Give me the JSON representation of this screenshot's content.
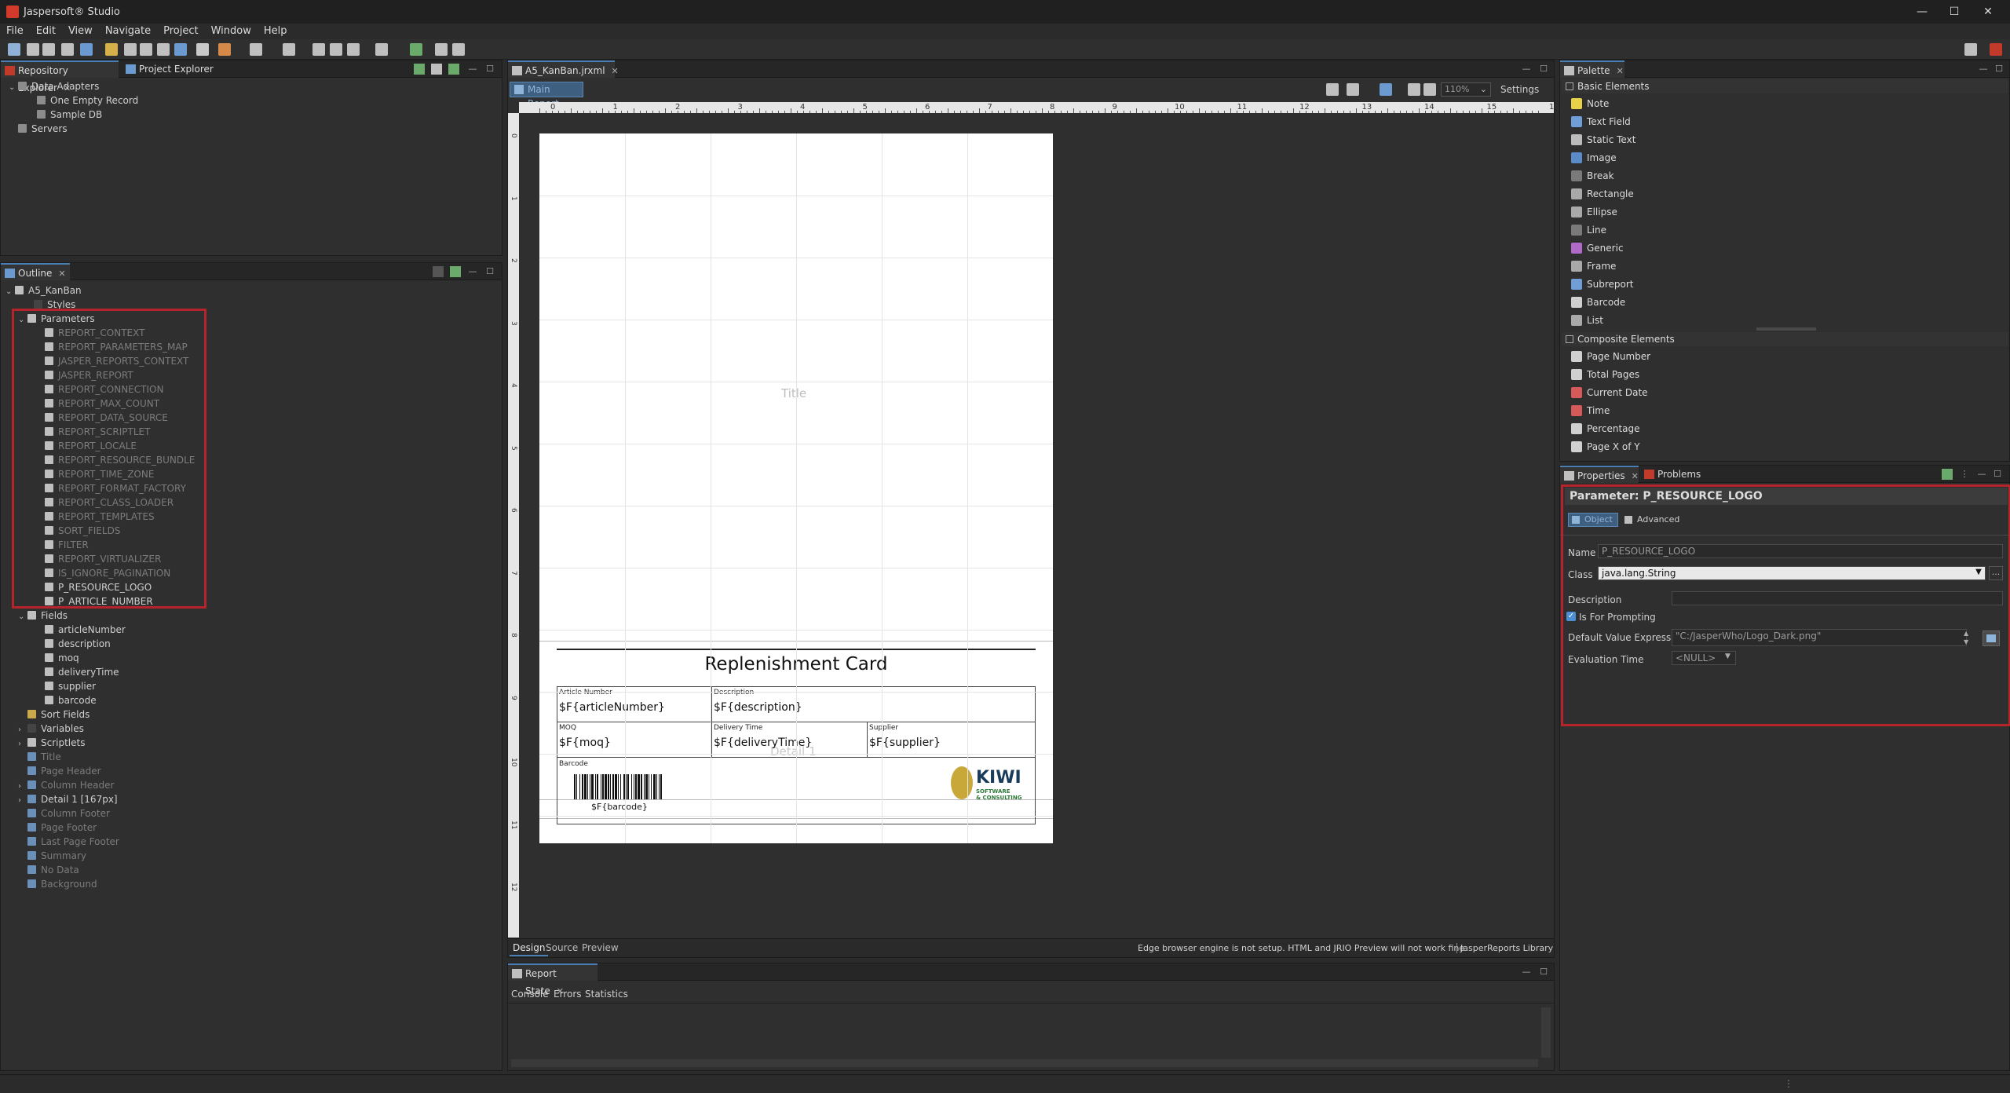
{
  "window": {
    "title": "Jaspersoft® Studio",
    "minimize": "—",
    "maximize": "☐",
    "close": "✕"
  },
  "menu": [
    "File",
    "Edit",
    "View",
    "Navigate",
    "Project",
    "Window",
    "Help"
  ],
  "repo": {
    "tab1": "Repository Explorer",
    "tab2": "Project Explorer",
    "items": [
      {
        "label": "Data Adapters",
        "level": 0,
        "arrow": "⌄"
      },
      {
        "label": "One Empty Record",
        "level": 1,
        "arrow": ""
      },
      {
        "label": "Sample DB",
        "level": 1,
        "arrow": ""
      },
      {
        "label": "Servers",
        "level": 0,
        "arrow": ""
      }
    ]
  },
  "outline": {
    "tab": "Outline",
    "root": "A5_KanBan",
    "styles": "Styles",
    "parameters": "Parameters",
    "params": [
      "REPORT_CONTEXT",
      "REPORT_PARAMETERS_MAP",
      "JASPER_REPORTS_CONTEXT",
      "JASPER_REPORT",
      "REPORT_CONNECTION",
      "REPORT_MAX_COUNT",
      "REPORT_DATA_SOURCE",
      "REPORT_SCRIPTLET",
      "REPORT_LOCALE",
      "REPORT_RESOURCE_BUNDLE",
      "REPORT_TIME_ZONE",
      "REPORT_FORMAT_FACTORY",
      "REPORT_CLASS_LOADER",
      "REPORT_TEMPLATES",
      "SORT_FIELDS",
      "FILTER",
      "REPORT_VIRTUALIZER",
      "IS_IGNORE_PAGINATION",
      "P_RESOURCE_LOGO",
      "P_ARTICLE_NUMBER"
    ],
    "fields": "Fields",
    "fieldItems": [
      "articleNumber",
      "description",
      "moq",
      "deliveryTime",
      "supplier",
      "barcode"
    ],
    "sortFields": "Sort Fields",
    "variables": "Variables",
    "scriptlets": "Scriptlets",
    "bands": [
      "Title",
      "Page Header",
      "Column Header",
      "Detail 1 [167px]",
      "Column Footer",
      "Page Footer",
      "Last Page Footer",
      "Summary",
      "No Data",
      "Background"
    ]
  },
  "editor": {
    "tab": "A5_KanBan.jrxml",
    "mainReport": "Main Report",
    "zoom": "110%",
    "settings": "Settings",
    "ruler": [
      "0",
      "1",
      "2",
      "3",
      "4",
      "5",
      "6",
      "7",
      "8",
      "9",
      "10",
      "11",
      "12",
      "13",
      "14",
      "15",
      "16"
    ],
    "vruler": [
      "0",
      "1",
      "2",
      "3",
      "4",
      "5",
      "6",
      "7",
      "8",
      "9",
      "10",
      "11",
      "12"
    ],
    "titleBand": "Title",
    "detailBand": "Detail 1",
    "card": {
      "heading": "Replenishment Card",
      "articleLbl": "Article Number",
      "articleFld": "$F{articleNumber}",
      "descLbl": "Description",
      "descFld": "$F{description}",
      "moqLbl": "MOQ",
      "moqFld": "$F{moq}",
      "delivLbl": "Delivery Time",
      "delivFld": "$F{deliveryTime}",
      "suppLbl": "Supplier",
      "suppFld": "$F{supplier}",
      "barcodeLbl": "Barcode",
      "barcodeFld": "$F{barcode}",
      "logoText": "KIWI",
      "logoSub1": "SOFTWARE",
      "logoSub2": "& CONSULTING"
    },
    "bottomTabs": [
      "Design",
      "Source",
      "Preview"
    ],
    "status": "Edge browser engine is not setup. HTML and JRIO Preview will not work fine",
    "lib": "JasperReports Library"
  },
  "reportState": {
    "tab": "Report State",
    "tabs": [
      "Console",
      "Errors",
      "Statistics"
    ]
  },
  "palette": {
    "tab": "Palette",
    "basicHeader": "Basic Elements",
    "basic": [
      {
        "label": "Note",
        "color": "#e8d24a"
      },
      {
        "label": "Text Field",
        "color": "#6f9fd6"
      },
      {
        "label": "Static Text",
        "color": "#bcbcbc"
      },
      {
        "label": "Image",
        "color": "#5b8cc9"
      },
      {
        "label": "Break",
        "color": "#7a7a7a"
      },
      {
        "label": "Rectangle",
        "color": "#a9a9a9"
      },
      {
        "label": "Ellipse",
        "color": "#a9a9a9"
      },
      {
        "label": "Line",
        "color": "#7a7a7a"
      },
      {
        "label": "Generic",
        "color": "#b06bc9"
      },
      {
        "label": "Frame",
        "color": "#a9a9a9"
      },
      {
        "label": "Subreport",
        "color": "#6f9fd6"
      },
      {
        "label": "Barcode",
        "color": "#d0d0d0"
      },
      {
        "label": "List",
        "color": "#a9a9a9"
      }
    ],
    "compositeHeader": "Composite Elements",
    "composite": [
      {
        "label": "Page Number",
        "color": "#d0d0d0"
      },
      {
        "label": "Total Pages",
        "color": "#d0d0d0"
      },
      {
        "label": "Current Date",
        "color": "#d65a5a"
      },
      {
        "label": "Time",
        "color": "#d65a5a"
      },
      {
        "label": "Percentage",
        "color": "#d0d0d0"
      },
      {
        "label": "Page X of Y",
        "color": "#d0d0d0"
      }
    ]
  },
  "properties": {
    "tab": "Properties",
    "tab2": "Problems",
    "header": "Parameter: P_RESOURCE_LOGO",
    "subtab1": "Object",
    "subtab2": "Advanced",
    "nameLbl": "Name",
    "nameVal": "P_RESOURCE_LOGO",
    "classLbl": "Class",
    "classVal": "java.lang.String",
    "descLbl": "Description",
    "descVal": "",
    "promptLbl": "Is For Prompting",
    "defLbl": "Default Value Expression",
    "defVal": "\"C:/JasperWho/Logo_Dark.png\"",
    "evalLbl": "Evaluation Time",
    "evalVal": "<NULL>",
    "dots": "..."
  }
}
